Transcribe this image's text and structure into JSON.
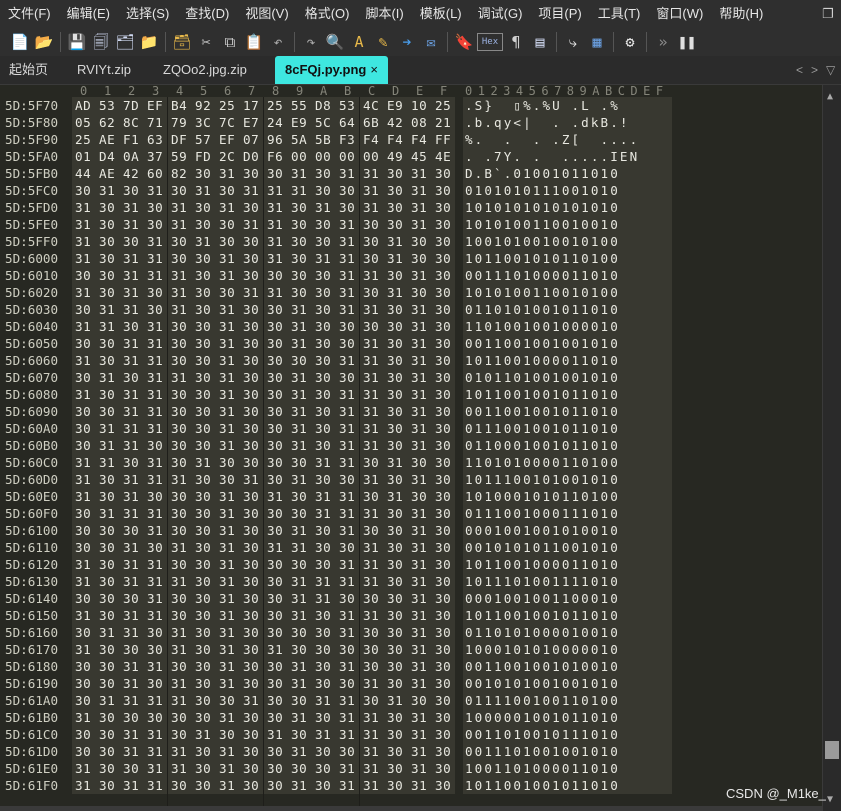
{
  "menu": [
    "文件(F)",
    "编辑(E)",
    "选择(S)",
    "查找(D)",
    "视图(V)",
    "格式(O)",
    "脚本(I)",
    "模板(L)",
    "调试(G)",
    "项目(P)",
    "工具(T)",
    "窗口(W)",
    "帮助(H)"
  ],
  "menu_restore_glyph": "❐",
  "toolbar": [
    {
      "name": "new-file-icon",
      "glyph": "📄"
    },
    {
      "name": "open-folder-icon",
      "glyph": "📂"
    },
    {
      "name": "save-icon",
      "glyph": "💾"
    },
    {
      "name": "save-all-icon",
      "glyph": "🗐"
    },
    {
      "name": "save-copy-icon",
      "glyph": "🗂"
    },
    {
      "name": "folder-icon",
      "glyph": "📁"
    },
    {
      "name": "open-project-icon",
      "glyph": "🗃"
    },
    {
      "name": "cut-icon",
      "glyph": "✂"
    },
    {
      "name": "copy-icon",
      "glyph": "⧉"
    },
    {
      "name": "paste-icon",
      "glyph": "📋"
    },
    {
      "name": "undo-icon",
      "glyph": "↶"
    },
    {
      "name": "redo-icon",
      "glyph": "↷"
    },
    {
      "name": "find-icon",
      "glyph": "🔍"
    },
    {
      "name": "replace-icon",
      "glyph": "A"
    },
    {
      "name": "find-in-files-icon",
      "glyph": "✎"
    },
    {
      "name": "goto-icon",
      "glyph": "➔"
    },
    {
      "name": "compare-icon",
      "glyph": "✉"
    },
    {
      "name": "bookmark-icon",
      "glyph": "🔖"
    },
    {
      "name": "hex-toggle-icon",
      "glyph": "Hex"
    },
    {
      "name": "show-whitespace-icon",
      "glyph": "¶"
    },
    {
      "name": "column-mode-icon",
      "glyph": "▤"
    },
    {
      "name": "word-wrap-icon",
      "glyph": "⤷"
    },
    {
      "name": "calculator-icon",
      "glyph": "▦"
    },
    {
      "name": "settings-icon",
      "glyph": "⚙"
    },
    {
      "name": "more-icon",
      "glyph": "»"
    },
    {
      "name": "pause-icon",
      "glyph": "❚❚"
    }
  ],
  "tabs": [
    {
      "label": "起始页",
      "active": false
    },
    {
      "label": "RVIYt.zip",
      "active": false
    },
    {
      "label": "ZQOo2.jpg.zip",
      "active": false
    },
    {
      "label": "8cFQj.py.png",
      "active": true
    }
  ],
  "tab_close_glyph": "×",
  "tab_nav": {
    "prev": "<",
    "next": ">",
    "menu": "▽"
  },
  "hex_column_headers": [
    "0",
    "1",
    "2",
    "3",
    "4",
    "5",
    "6",
    "7",
    "8",
    "9",
    "A",
    "B",
    "C",
    "D",
    "E",
    "F"
  ],
  "text_column_header": "0123456789ABCDEF",
  "rows": [
    {
      "addr": "5D:5F70",
      "hex": [
        "AD",
        "53",
        "7D",
        "EF",
        "B4",
        "92",
        "25",
        "17",
        "25",
        "55",
        "D8",
        "53",
        "4C",
        "E9",
        "10",
        "25"
      ],
      "text": ".S}  ▯%.%U .L .%"
    },
    {
      "addr": "5D:5F80",
      "hex": [
        "05",
        "62",
        "8C",
        "71",
        "79",
        "3C",
        "7C",
        "E7",
        "24",
        "E9",
        "5C",
        "64",
        "6B",
        "42",
        "08",
        "21"
      ],
      "text": ".b.qy<|  . .dkB.!"
    },
    {
      "addr": "5D:5F90",
      "hex": [
        "25",
        "AE",
        "F1",
        "63",
        "DF",
        "57",
        "EF",
        "07",
        "96",
        "5A",
        "5B",
        "F3",
        "F4",
        "F4",
        "F4",
        "FF"
      ],
      "text": "%.  .  . .Z[  ...."
    },
    {
      "addr": "5D:5FA0",
      "hex": [
        "01",
        "D4",
        "0A",
        "37",
        "59",
        "FD",
        "2C",
        "D0",
        "F6",
        "00",
        "00",
        "00",
        "00",
        "49",
        "45",
        "4E"
      ],
      "text": ". .7Y. .  .....IEN"
    },
    {
      "addr": "5D:5FB0",
      "hex": [
        "44",
        "AE",
        "42",
        "60",
        "82",
        "30",
        "31",
        "30",
        "30",
        "31",
        "30",
        "31",
        "31",
        "30",
        "31",
        "30"
      ],
      "text": "D.B`.01001011010"
    },
    {
      "addr": "5D:5FC0",
      "hex": [
        "30",
        "31",
        "30",
        "31",
        "30",
        "31",
        "30",
        "31",
        "31",
        "31",
        "30",
        "30",
        "31",
        "30",
        "31",
        "30"
      ],
      "text": "0101010111001010"
    },
    {
      "addr": "5D:5FD0",
      "hex": [
        "31",
        "30",
        "31",
        "30",
        "31",
        "30",
        "31",
        "30",
        "31",
        "30",
        "31",
        "30",
        "31",
        "30",
        "31",
        "30"
      ],
      "text": "1010101010101010"
    },
    {
      "addr": "5D:5FE0",
      "hex": [
        "31",
        "30",
        "31",
        "30",
        "31",
        "30",
        "30",
        "31",
        "31",
        "30",
        "30",
        "31",
        "30",
        "30",
        "31",
        "30"
      ],
      "text": "1010100110010010"
    },
    {
      "addr": "5D:5FF0",
      "hex": [
        "31",
        "30",
        "30",
        "31",
        "30",
        "31",
        "30",
        "30",
        "31",
        "30",
        "30",
        "31",
        "30",
        "31",
        "30",
        "30"
      ],
      "text": "1001010010010100"
    },
    {
      "addr": "5D:6000",
      "hex": [
        "31",
        "30",
        "31",
        "31",
        "30",
        "30",
        "31",
        "30",
        "31",
        "30",
        "31",
        "31",
        "30",
        "31",
        "30",
        "30"
      ],
      "text": "1011001010110100"
    },
    {
      "addr": "5D:6010",
      "hex": [
        "30",
        "30",
        "31",
        "31",
        "31",
        "30",
        "31",
        "30",
        "30",
        "30",
        "30",
        "31",
        "31",
        "30",
        "31",
        "30"
      ],
      "text": "0011101000011010"
    },
    {
      "addr": "5D:6020",
      "hex": [
        "31",
        "30",
        "31",
        "30",
        "31",
        "30",
        "30",
        "31",
        "31",
        "30",
        "30",
        "31",
        "30",
        "31",
        "30",
        "30"
      ],
      "text": "1010100110010100"
    },
    {
      "addr": "5D:6030",
      "hex": [
        "30",
        "31",
        "31",
        "30",
        "31",
        "30",
        "31",
        "30",
        "30",
        "31",
        "30",
        "31",
        "31",
        "30",
        "31",
        "30"
      ],
      "text": "0110101001011010"
    },
    {
      "addr": "5D:6040",
      "hex": [
        "31",
        "31",
        "30",
        "31",
        "30",
        "30",
        "31",
        "30",
        "30",
        "31",
        "30",
        "30",
        "30",
        "30",
        "31",
        "30"
      ],
      "text": "1101001001000010"
    },
    {
      "addr": "5D:6050",
      "hex": [
        "30",
        "30",
        "31",
        "31",
        "30",
        "30",
        "31",
        "30",
        "30",
        "31",
        "30",
        "30",
        "31",
        "30",
        "31",
        "30"
      ],
      "text": "0011001001001010"
    },
    {
      "addr": "5D:6060",
      "hex": [
        "31",
        "30",
        "31",
        "31",
        "30",
        "30",
        "31",
        "30",
        "30",
        "30",
        "30",
        "31",
        "31",
        "30",
        "31",
        "30"
      ],
      "text": "1011001000011010"
    },
    {
      "addr": "5D:6070",
      "hex": [
        "30",
        "31",
        "30",
        "31",
        "31",
        "30",
        "31",
        "30",
        "30",
        "31",
        "30",
        "30",
        "31",
        "30",
        "31",
        "30"
      ],
      "text": "0101101001001010"
    },
    {
      "addr": "5D:6080",
      "hex": [
        "31",
        "30",
        "31",
        "31",
        "30",
        "30",
        "31",
        "30",
        "30",
        "31",
        "30",
        "31",
        "31",
        "30",
        "31",
        "30"
      ],
      "text": "1011001001011010"
    },
    {
      "addr": "5D:6090",
      "hex": [
        "30",
        "30",
        "31",
        "31",
        "30",
        "30",
        "31",
        "30",
        "30",
        "31",
        "30",
        "31",
        "31",
        "30",
        "31",
        "30"
      ],
      "text": "0011001001011010"
    },
    {
      "addr": "5D:60A0",
      "hex": [
        "30",
        "31",
        "31",
        "31",
        "30",
        "30",
        "31",
        "30",
        "30",
        "31",
        "30",
        "31",
        "31",
        "30",
        "31",
        "30"
      ],
      "text": "0111001001011010"
    },
    {
      "addr": "5D:60B0",
      "hex": [
        "30",
        "31",
        "31",
        "30",
        "30",
        "30",
        "31",
        "30",
        "30",
        "31",
        "30",
        "31",
        "31",
        "30",
        "31",
        "30"
      ],
      "text": "0110001001011010"
    },
    {
      "addr": "5D:60C0",
      "hex": [
        "31",
        "31",
        "30",
        "31",
        "30",
        "31",
        "30",
        "30",
        "30",
        "30",
        "31",
        "31",
        "30",
        "31",
        "30",
        "30"
      ],
      "text": "1101010000110100"
    },
    {
      "addr": "5D:60D0",
      "hex": [
        "31",
        "30",
        "31",
        "31",
        "31",
        "30",
        "30",
        "31",
        "30",
        "31",
        "30",
        "30",
        "31",
        "30",
        "31",
        "30"
      ],
      "text": "1011100101001010"
    },
    {
      "addr": "5D:60E0",
      "hex": [
        "31",
        "30",
        "31",
        "30",
        "30",
        "30",
        "31",
        "30",
        "31",
        "30",
        "31",
        "31",
        "30",
        "31",
        "30",
        "30"
      ],
      "text": "1010001010110100"
    },
    {
      "addr": "5D:60F0",
      "hex": [
        "30",
        "31",
        "31",
        "31",
        "30",
        "30",
        "31",
        "30",
        "30",
        "30",
        "31",
        "31",
        "31",
        "30",
        "31",
        "30"
      ],
      "text": "0111001000111010"
    },
    {
      "addr": "5D:6100",
      "hex": [
        "30",
        "30",
        "30",
        "31",
        "30",
        "30",
        "31",
        "30",
        "30",
        "31",
        "30",
        "31",
        "30",
        "30",
        "31",
        "30"
      ],
      "text": "0001001001010010"
    },
    {
      "addr": "5D:6110",
      "hex": [
        "30",
        "30",
        "31",
        "30",
        "31",
        "30",
        "31",
        "30",
        "31",
        "31",
        "30",
        "30",
        "31",
        "30",
        "31",
        "30"
      ],
      "text": "0010101011001010"
    },
    {
      "addr": "5D:6120",
      "hex": [
        "31",
        "30",
        "31",
        "31",
        "30",
        "30",
        "31",
        "30",
        "30",
        "30",
        "30",
        "31",
        "31",
        "30",
        "31",
        "30"
      ],
      "text": "1011001000011010"
    },
    {
      "addr": "5D:6130",
      "hex": [
        "31",
        "30",
        "31",
        "31",
        "31",
        "30",
        "31",
        "30",
        "30",
        "31",
        "31",
        "31",
        "31",
        "30",
        "31",
        "30"
      ],
      "text": "1011101001111010"
    },
    {
      "addr": "5D:6140",
      "hex": [
        "30",
        "30",
        "30",
        "31",
        "30",
        "30",
        "31",
        "30",
        "30",
        "31",
        "31",
        "30",
        "30",
        "30",
        "31",
        "30"
      ],
      "text": "0001001001100010"
    },
    {
      "addr": "5D:6150",
      "hex": [
        "31",
        "30",
        "31",
        "31",
        "30",
        "30",
        "31",
        "30",
        "30",
        "31",
        "30",
        "31",
        "31",
        "30",
        "31",
        "30"
      ],
      "text": "1011001001011010"
    },
    {
      "addr": "5D:6160",
      "hex": [
        "30",
        "31",
        "31",
        "30",
        "31",
        "30",
        "31",
        "30",
        "30",
        "30",
        "30",
        "31",
        "30",
        "30",
        "31",
        "30"
      ],
      "text": "0110101000010010"
    },
    {
      "addr": "5D:6170",
      "hex": [
        "31",
        "30",
        "30",
        "30",
        "31",
        "30",
        "31",
        "30",
        "31",
        "30",
        "30",
        "30",
        "30",
        "30",
        "31",
        "30"
      ],
      "text": "1000101010000010"
    },
    {
      "addr": "5D:6180",
      "hex": [
        "30",
        "30",
        "31",
        "31",
        "30",
        "30",
        "31",
        "30",
        "30",
        "31",
        "30",
        "31",
        "30",
        "30",
        "31",
        "30"
      ],
      "text": "0011001001010010"
    },
    {
      "addr": "5D:6190",
      "hex": [
        "30",
        "30",
        "31",
        "30",
        "31",
        "30",
        "31",
        "30",
        "30",
        "31",
        "30",
        "30",
        "31",
        "30",
        "31",
        "30"
      ],
      "text": "0010101001001010"
    },
    {
      "addr": "5D:61A0",
      "hex": [
        "30",
        "31",
        "31",
        "31",
        "31",
        "30",
        "30",
        "31",
        "30",
        "30",
        "31",
        "31",
        "30",
        "31",
        "30",
        "30"
      ],
      "text": "0111100100110100"
    },
    {
      "addr": "5D:61B0",
      "hex": [
        "31",
        "30",
        "30",
        "30",
        "30",
        "30",
        "31",
        "30",
        "30",
        "31",
        "30",
        "31",
        "31",
        "30",
        "31",
        "30"
      ],
      "text": "1000001001011010"
    },
    {
      "addr": "5D:61C0",
      "hex": [
        "30",
        "30",
        "31",
        "31",
        "30",
        "31",
        "30",
        "30",
        "31",
        "30",
        "31",
        "31",
        "31",
        "30",
        "31",
        "30"
      ],
      "text": "0011010010111010"
    },
    {
      "addr": "5D:61D0",
      "hex": [
        "30",
        "30",
        "31",
        "31",
        "31",
        "30",
        "31",
        "30",
        "30",
        "31",
        "30",
        "30",
        "31",
        "30",
        "31",
        "30"
      ],
      "text": "0011101001001010"
    },
    {
      "addr": "5D:61E0",
      "hex": [
        "31",
        "30",
        "30",
        "31",
        "31",
        "30",
        "31",
        "30",
        "30",
        "30",
        "30",
        "31",
        "31",
        "30",
        "31",
        "30"
      ],
      "text": "1001101000011010"
    },
    {
      "addr": "5D:61F0",
      "hex": [
        "31",
        "30",
        "31",
        "31",
        "30",
        "30",
        "31",
        "30",
        "30",
        "31",
        "30",
        "31",
        "31",
        "30",
        "31",
        "30"
      ],
      "text": "1011001001011010"
    }
  ],
  "scrollbar": {
    "up": "▲",
    "down": "▼",
    "position_fraction": 0.95
  },
  "watermark": "CSDN @_M1ke_",
  "colors": {
    "background": "#272822",
    "tab_active": "#3ee7e0",
    "cell_highlight": "#383830"
  }
}
